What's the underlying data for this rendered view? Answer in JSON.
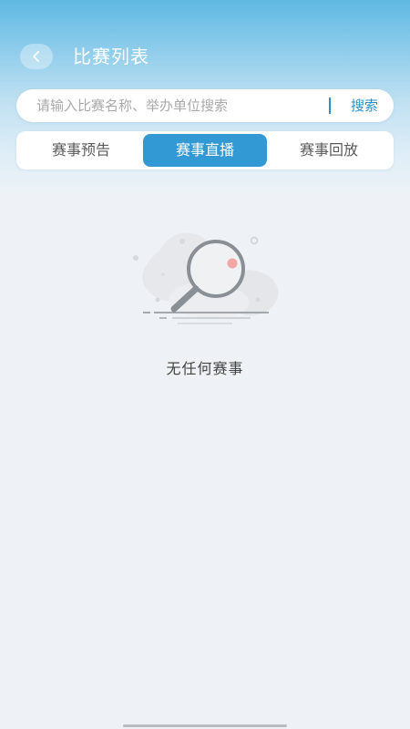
{
  "header": {
    "title": "比赛列表",
    "back_icon": "chevron-left-icon"
  },
  "search": {
    "placeholder": "请输入比赛名称、举办单位搜索",
    "value": "",
    "button_label": "搜索"
  },
  "tabs": [
    {
      "label": "赛事预告",
      "active": false
    },
    {
      "label": "赛事直播",
      "active": true
    },
    {
      "label": "赛事回放",
      "active": false
    }
  ],
  "empty_state": {
    "icon": "magnifier-empty-icon",
    "message": "无任何赛事"
  },
  "colors": {
    "accent": "#3399d4",
    "header_gradient_top": "#5fb9e2",
    "background": "#eef2f6"
  }
}
